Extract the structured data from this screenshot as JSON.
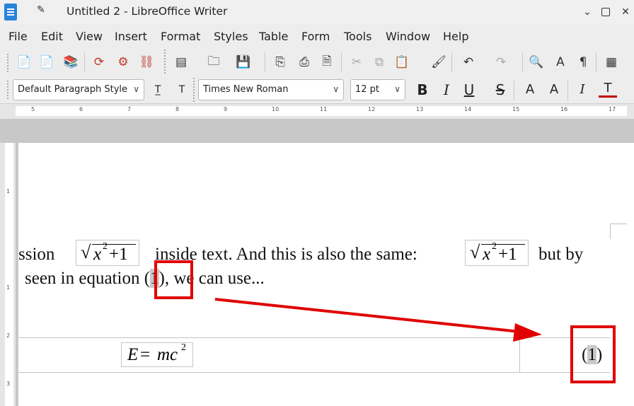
{
  "window": {
    "title": "Untitled 2 - LibreOffice Writer"
  },
  "menu": [
    "File",
    "Edit",
    "View",
    "Insert",
    "Format",
    "Styles",
    "Table",
    "Form",
    "Tools",
    "Window",
    "Help"
  ],
  "toolbar": {
    "paragraph_style": "Default Paragraph Style",
    "font_name": "Times New Roman",
    "font_size": "12 pt"
  },
  "ruler": {
    "labels": [
      "5",
      "6",
      "7",
      "8",
      "9",
      "10",
      "11",
      "12",
      "13",
      "14",
      "15",
      "16",
      "17"
    ]
  },
  "vruler": {
    "labels": [
      "1",
      "1",
      "2",
      "3"
    ]
  },
  "document": {
    "line1_a": "ssion",
    "line1_b": "inside text. And this is also the same:",
    "line1_c": "but by",
    "line2_a": "seen in equation (",
    "line2_num": "1",
    "line2_b": "), we can use...",
    "inline_formula_1": "√x²+1",
    "inline_formula_2": "√x²+1",
    "display_formula": "E=mc²",
    "equation_number_open": "(",
    "equation_number": "1",
    "equation_number_close": ")"
  },
  "annotation": {
    "arrow_color": "#e00000"
  }
}
